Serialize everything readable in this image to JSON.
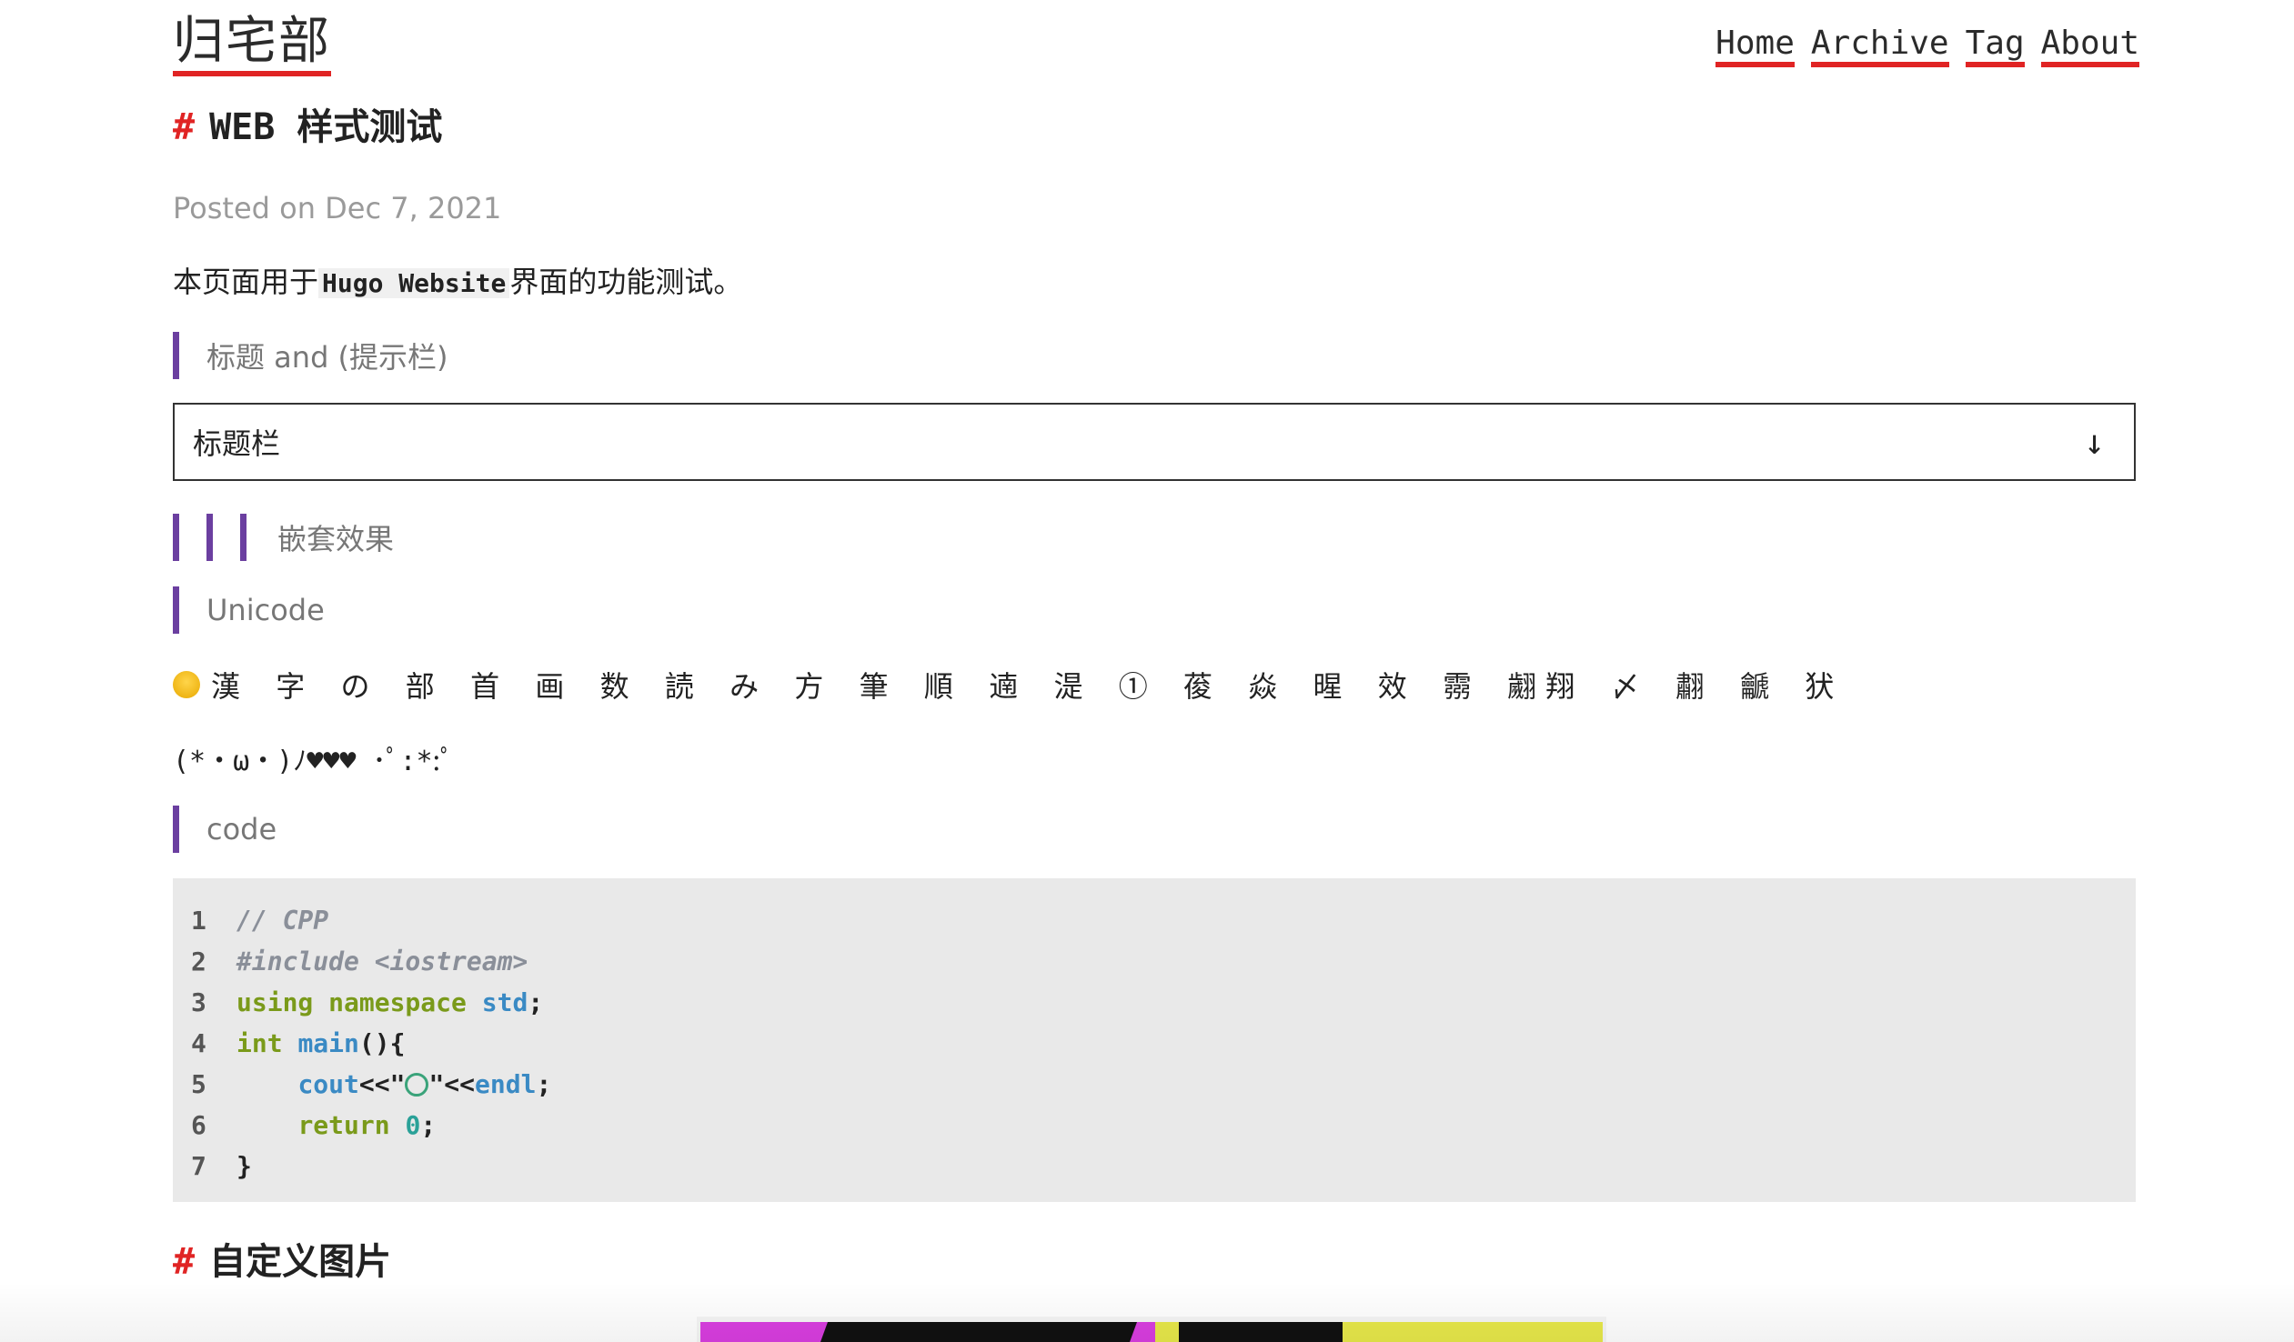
{
  "header": {
    "site_title": "归宅部",
    "nav": [
      "Home",
      "Archive",
      "Tag",
      "About"
    ]
  },
  "post": {
    "title_hash": "#",
    "title": "WEB 样式测试",
    "meta": "Posted on Dec 7, 2021",
    "intro_prefix": "本页面用于",
    "intro_code": "Hugo Website",
    "intro_suffix": "界面的功能测试。",
    "quote_heading": "标题 and (提示栏)",
    "details_summary": "标题栏",
    "details_arrow": "↓",
    "nested_quote": "嵌套效果",
    "unicode_heading": "Unicode",
    "unicode_text": "漢 字 の 部 首 画 数 読 み 方 筆 順 遖 湜 ① 葰 焱 暒 效 霛 翽翔 〆 䎘 䶵 犾",
    "kaomoji": "(*・ω・)ﾉ♥♥♥ ･ﾟ:*:ﾟ",
    "code_heading": "code",
    "code_lines": [
      {
        "n": "1"
      },
      {
        "n": "2"
      },
      {
        "n": "3"
      },
      {
        "n": "4"
      },
      {
        "n": "5"
      },
      {
        "n": "6"
      },
      {
        "n": "7"
      }
    ],
    "code": {
      "l1": "// CPP",
      "l2": "#include <iostream>",
      "l3_kw": "using namespace",
      "l3_fn": "std",
      "l3_end": ";",
      "l4_kw": "int",
      "l4_fn": "main",
      "l4_end": "(){",
      "l5_fn": "cout",
      "l5_a": "<<\"",
      "l5_b": "\"<<",
      "l5_fn2": "endl",
      "l5_end": ";",
      "l6_kw": "return",
      "l6_num": "0",
      "l6_end": ";",
      "l7": "}"
    },
    "section2_hash": "#",
    "section2_title": "自定义图片"
  },
  "colors": {
    "accent": "#e02424",
    "quote_bar": "#6b3fa0",
    "code_bg": "#e9e9e9",
    "keyword": "#7a9a1a",
    "function": "#3a8ac4",
    "comment": "#8a8f99"
  }
}
